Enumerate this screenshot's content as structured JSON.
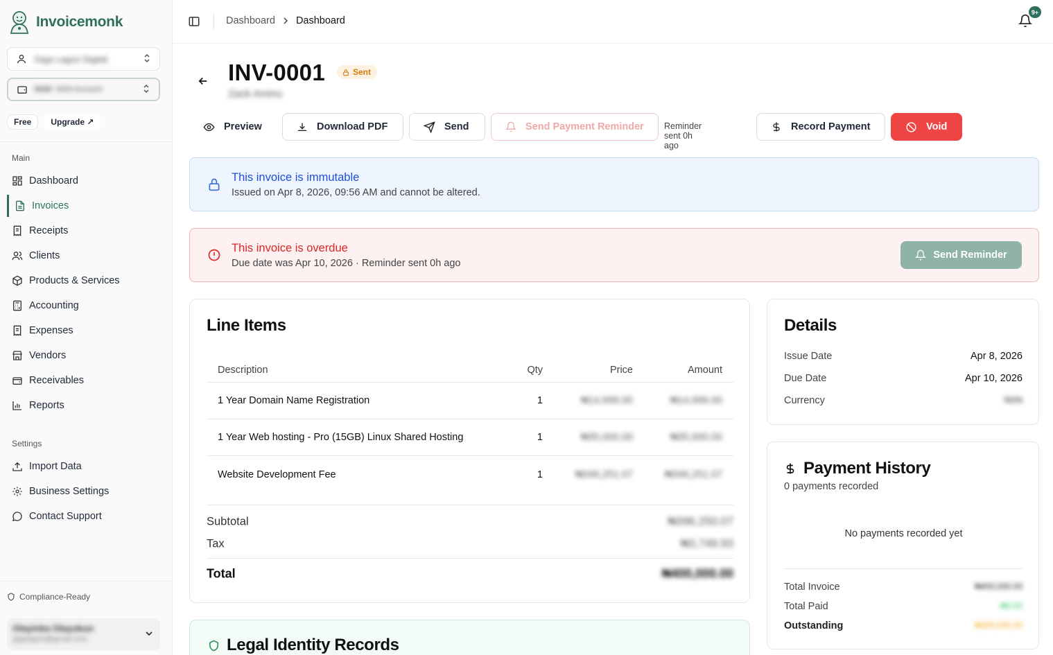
{
  "app": {
    "name": "Invoicemonk"
  },
  "sidebar": {
    "business": "Giga Lagos Digital",
    "account": {
      "code": "NGN",
      "name": "NGN Account"
    },
    "plan": "Free",
    "upgrade": "Upgrade ↗",
    "main_label": "Main",
    "main_items": [
      {
        "label": "Dashboard",
        "icon": "grid-icon"
      },
      {
        "label": "Invoices",
        "icon": "file-text-icon",
        "active": true
      },
      {
        "label": "Receipts",
        "icon": "receipt-icon"
      },
      {
        "label": "Clients",
        "icon": "users-icon"
      },
      {
        "label": "Products & Services",
        "icon": "package-icon"
      },
      {
        "label": "Accounting",
        "icon": "calculator-icon"
      },
      {
        "label": "Expenses",
        "icon": "receipt-icon"
      },
      {
        "label": "Vendors",
        "icon": "store-icon"
      },
      {
        "label": "Receivables",
        "icon": "wallet-icon"
      },
      {
        "label": "Reports",
        "icon": "bar-chart-icon"
      }
    ],
    "settings_label": "Settings",
    "settings_items": [
      {
        "label": "Import Data",
        "icon": "upload-icon"
      },
      {
        "label": "Business Settings",
        "icon": "gear-icon"
      },
      {
        "label": "Contact Support",
        "icon": "message-icon"
      }
    ],
    "compliance": "Compliance-Ready",
    "user": {
      "name": "Olayinka Olayokun",
      "email": "gigalagos@gmail.com"
    }
  },
  "topbar": {
    "breadcrumb": [
      "Dashboard",
      "Dashboard"
    ],
    "notification_count": "9+"
  },
  "invoice": {
    "number": "INV-0001",
    "status": "Sent",
    "client": "Zack Aminu"
  },
  "actions": {
    "preview": "Preview",
    "download": "Download PDF",
    "send": "Send",
    "reminder": "Send Payment Reminder",
    "reminder_note": "Reminder sent 0h ago",
    "record": "Record Payment",
    "void": "Void"
  },
  "alerts": {
    "immutable_title": "This invoice is immutable",
    "immutable_sub": "Issued on Apr 8, 2026, 09:56 AM and cannot be altered.",
    "overdue_title": "This invoice is overdue",
    "overdue_sub": "Due date was Apr 10, 2026 · Reminder sent 0h ago",
    "send_reminder": "Send Reminder"
  },
  "line_items": {
    "title": "Line Items",
    "headers": {
      "description": "Description",
      "qty": "Qty",
      "price": "Price",
      "amount": "Amount"
    },
    "rows": [
      {
        "description": "1 Year Domain Name Registration",
        "qty": "1",
        "price": "₦14,999.00",
        "amount": "₦14,999.00"
      },
      {
        "description": "1 Year Web hosting - Pro (15GB) Linux Shared Hosting",
        "qty": "1",
        "price": "₦35,000.00",
        "amount": "₦35,000.00"
      },
      {
        "description": "Website Development Fee",
        "qty": "1",
        "price": "₦346,251.07",
        "amount": "₦346,251.07"
      }
    ],
    "subtotal_label": "Subtotal",
    "subtotal": "₦396,250.07",
    "tax_label": "Tax",
    "tax": "₦3,749.93",
    "total_label": "Total",
    "total": "₦400,000.00"
  },
  "details": {
    "title": "Details",
    "issue_label": "Issue Date",
    "issue": "Apr 8, 2026",
    "due_label": "Due Date",
    "due": "Apr 10, 2026",
    "currency_label": "Currency",
    "currency": "NGN"
  },
  "payments": {
    "title": "Payment History",
    "count": "0 payments recorded",
    "empty": "No payments recorded yet",
    "total_invoice_label": "Total Invoice",
    "total_invoice": "₦400,000.00",
    "total_paid_label": "Total Paid",
    "total_paid": "₦0.00",
    "outstanding_label": "Outstanding",
    "outstanding": "₦400,000.00"
  },
  "legal": {
    "title": "Legal Identity Records"
  },
  "colors": {
    "brand": "#2f6f5e",
    "danger": "#ef4444",
    "info": "#1d4ed8",
    "warning": "#d07c14",
    "paid": "#22c55e"
  }
}
